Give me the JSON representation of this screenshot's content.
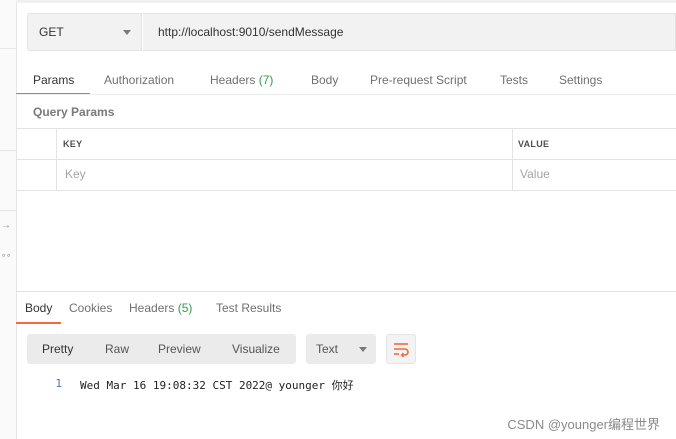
{
  "request": {
    "method": "GET",
    "url": "http://localhost:9010/sendMessage"
  },
  "request_tabs": [
    {
      "label": "Params",
      "count": ""
    },
    {
      "label": "Authorization",
      "count": ""
    },
    {
      "label": "Headers",
      "count": "(7)"
    },
    {
      "label": "Body",
      "count": ""
    },
    {
      "label": "Pre-request Script",
      "count": ""
    },
    {
      "label": "Tests",
      "count": ""
    },
    {
      "label": "Settings",
      "count": ""
    }
  ],
  "query_params": {
    "title": "Query Params",
    "key_header": "KEY",
    "value_header": "VALUE",
    "key_placeholder": "Key",
    "value_placeholder": "Value"
  },
  "response_tabs": [
    {
      "label": "Body",
      "count": ""
    },
    {
      "label": "Cookies",
      "count": ""
    },
    {
      "label": "Headers",
      "count": "(5)"
    },
    {
      "label": "Test Results",
      "count": ""
    }
  ],
  "view_modes": [
    "Pretty",
    "Raw",
    "Preview",
    "Visualize"
  ],
  "format": "Text",
  "response_body": {
    "line_number": "1",
    "text": "Wed Mar 16 19:08:32 CST 2022@ younger 你好"
  },
  "left_rail": {
    "arrow": "→",
    "dots": "∘∘"
  },
  "watermark": "CSDN @younger编程世界",
  "colors": {
    "accent": "#f26b3a",
    "count_green": "#2d9f4e",
    "line_number_blue": "#4a73b5"
  },
  "icons": [
    "chevron-down-icon",
    "wrap-lines-icon",
    "arrow-right-icon",
    "more-icon"
  ]
}
